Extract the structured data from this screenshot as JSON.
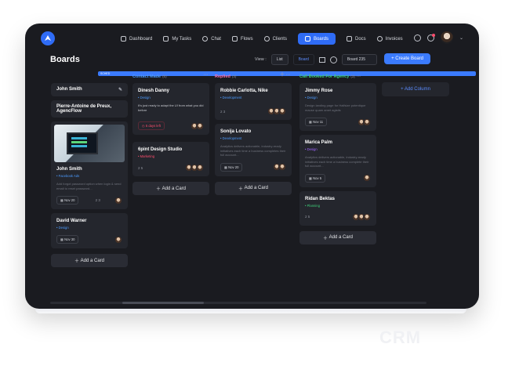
{
  "nav": {
    "items": [
      "Dashboard",
      "My Tasks",
      "Chat",
      "Flows",
      "Clients",
      "Boards",
      "Docs",
      "Invoices"
    ],
    "active": "Boards"
  },
  "page": {
    "title": "Boards"
  },
  "toolbar": {
    "view_label": "View :",
    "list_label": "List",
    "board_label": "Board",
    "board_select": "Board 235",
    "create_label": "+ Create Board"
  },
  "columns": [
    {
      "name": "",
      "count": "",
      "color": "#ffffff",
      "cards": [
        {
          "kind": "simple",
          "title": "John Smith"
        },
        {
          "kind": "simple",
          "title": "Pierre-Antoine de Preux, AgencFlow"
        },
        {
          "kind": "image",
          "badge": "SCHED",
          "title": "John Smith",
          "tag": "Facebook Ads",
          "tag_color": "#4c9bff",
          "desc": "Add forgot password option when login & send email to reset password...",
          "date": "Nov 20",
          "counts": "2  3"
        },
        {
          "kind": "card",
          "title": "David Warner",
          "tag": "Design",
          "tag_color": "#4c9bff",
          "date": "Nov 30"
        }
      ],
      "add": "Add a Card"
    },
    {
      "name": "Contact Made",
      "count": "(5)",
      "color": "#4c9bff",
      "cards": [
        {
          "kind": "card",
          "title": "Dinesh Danny",
          "tag": "Design",
          "tag_color": "#4c9bff",
          "desc": "It's just ready to adapt the UI from what you did before",
          "late": "5 days left"
        },
        {
          "kind": "card",
          "title": "6pint Design Studio",
          "tag": "Marketing",
          "tag_color": "#ff4d6d",
          "counts": "2  5"
        }
      ],
      "add": "Add a Card"
    },
    {
      "name": "Replied",
      "count": "(3)",
      "color": "#ff6fa8",
      "cards": [
        {
          "kind": "card",
          "title": "Robbie Carlotta, Nike",
          "tag": "Development",
          "tag_color": "#4c9bff",
          "counts": "2  3"
        },
        {
          "kind": "card",
          "title": "Sonija Lovato",
          "tag": "Development",
          "tag_color": "#4c9bff",
          "desc": "Analytics delivers actionable, industry-ready initiatives each time a business completes their full account...",
          "date": "Nov 20"
        }
      ],
      "add": "Add a Card"
    },
    {
      "name": "Call Booked For Agency",
      "count": "(3)",
      "color": "#3fd07a",
      "cards": [
        {
          "kind": "card",
          "title": "Jimmy Rose",
          "tag": "Design",
          "tag_color": "#4c9bff",
          "desc": "Design landing page for Halfsize potentique mause quam amet agistis",
          "date": "Nov 11"
        },
        {
          "kind": "card",
          "title": "Marica Palm",
          "tag": "Design",
          "tag_color": "#a066ff",
          "desc": "Analytics delivers actionable, industry-ready initiatives each time a business complete their full account...",
          "date": "Nov 5"
        },
        {
          "kind": "card",
          "title": "Ridan Bektas",
          "tag": "Planning",
          "tag_color": "#3fd07a",
          "counts": "2  5"
        }
      ],
      "add": "Add a Card"
    }
  ],
  "add_column": "+ Add Column",
  "watermark": "CRM"
}
